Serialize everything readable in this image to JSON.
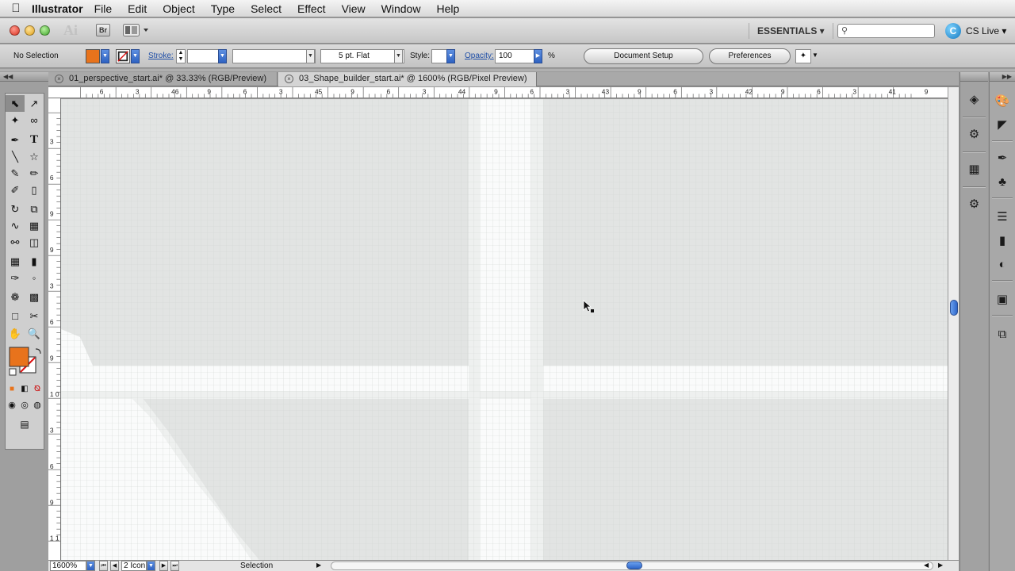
{
  "menubar": {
    "app_name": "Illustrator",
    "items": [
      "File",
      "Edit",
      "Object",
      "Type",
      "Select",
      "Effect",
      "View",
      "Window",
      "Help"
    ]
  },
  "appbar": {
    "logo": "Ai",
    "bridge_label": "Br",
    "workspace": "ESSENTIALS ▾",
    "search_placeholder": "",
    "cs_live_label": "CS Live ▾"
  },
  "control": {
    "selection_status": "No Selection",
    "fill_color": "#e8731c",
    "stroke_label": "Stroke:",
    "brush_value": "5 pt. Flat",
    "style_label": "Style:",
    "opacity_label": "Opacity:",
    "opacity_value": "100",
    "percent": "%",
    "document_setup": "Document Setup",
    "preferences": "Preferences"
  },
  "tabs": [
    {
      "label": "01_perspective_start.ai* @ 33.33% (RGB/Preview)"
    },
    {
      "label": "03_Shape_builder_start.ai* @ 1600% (RGB/Pixel Preview)"
    }
  ],
  "ruler": {
    "top_labels": [
      "6",
      "3",
      "46",
      "9",
      "6",
      "3",
      "45",
      "9",
      "6",
      "3",
      "44",
      "9",
      "6",
      "3",
      "43",
      "9",
      "6",
      "3",
      "42",
      "9",
      "6",
      "3",
      "41",
      "9"
    ],
    "left_labels": [
      "3",
      "6",
      "9",
      "9",
      "3",
      "6",
      "9",
      "1 0",
      "3",
      "6",
      "9",
      "1 1"
    ]
  },
  "status": {
    "zoom": "1600%",
    "artboard": "2 Icon",
    "tool_name": "Selection"
  },
  "colors": {
    "fill": "#e8731c",
    "canvas_gray": "#e2e4e3",
    "shape_white": "#fafbfb",
    "accent_blue": "#2e62c2"
  },
  "icons": {
    "tools": [
      "selection-arrow",
      "direct-selection",
      "magic-wand",
      "lasso",
      "pen",
      "type-T",
      "line-segment",
      "star",
      "paintbrush",
      "pencil",
      "blob-brush",
      "eraser",
      "rotate",
      "scale",
      "warp",
      "free-transform",
      "shape-builder",
      "live-paint",
      "mesh",
      "gradient",
      "eyedropper",
      "blend",
      "symbol-sprayer",
      "column-graph",
      "artboard",
      "slice",
      "hand",
      "zoom"
    ],
    "dock_left": [
      "layers",
      "symbols",
      "align",
      "graphic-styles"
    ],
    "dock_right": [
      "color",
      "color-guide",
      "brushes",
      "symbols",
      "stroke",
      "gradient",
      "transparency",
      "appearance",
      "pathfinder"
    ]
  }
}
